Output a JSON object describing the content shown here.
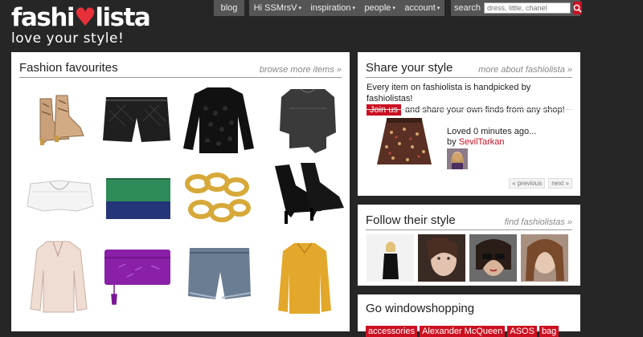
{
  "brand": {
    "logo_part1": "fashi",
    "logo_heart": "o",
    "logo_part2": "lista",
    "tagline": "love your style!"
  },
  "nav": {
    "blog": "blog",
    "greeting": "Hi SSMrsV",
    "inspiration": "inspiration",
    "people": "people",
    "account": "account",
    "caret": "▾"
  },
  "search": {
    "label": "search",
    "placeholder": "dress, little, chanel"
  },
  "favourites": {
    "title": "Fashion favourites",
    "more_link": "browse more items »",
    "items": [
      {
        "name": "snake-print-ankle-boots"
      },
      {
        "name": "leather-quilted-shorts"
      },
      {
        "name": "black-knit-sweater"
      },
      {
        "name": "black-sheer-top"
      },
      {
        "name": "white-collar-top"
      },
      {
        "name": "green-navy-clutch"
      },
      {
        "name": "gold-chain-bracelet"
      },
      {
        "name": "black-platform-booties"
      },
      {
        "name": "sheer-blush-blouse"
      },
      {
        "name": "purple-snake-clutch"
      },
      {
        "name": "denim-cutoff-shorts"
      },
      {
        "name": "mustard-sweater"
      }
    ]
  },
  "share": {
    "title": "Share your style",
    "more_link": "more about fashiolista »",
    "intro": "Every item on fashiolista is handpicked by fashiolistas!",
    "join_label": "Join us",
    "intro_rest": "and share your own finds from any shop!",
    "loved": "Loved 0 minutes ago...",
    "by_label": "by",
    "by_user": "SevilTarkan",
    "prev": "« previous",
    "next": "next »"
  },
  "follow": {
    "title": "Follow their style",
    "more_link": "find fashiolistas »"
  },
  "shop": {
    "title": "Go windowshopping",
    "tags": [
      "accessories",
      "Alexander McQueen",
      "ASOS",
      "bag"
    ]
  },
  "colors": {
    "accent_red": "#cc1021",
    "background": "#262626"
  }
}
